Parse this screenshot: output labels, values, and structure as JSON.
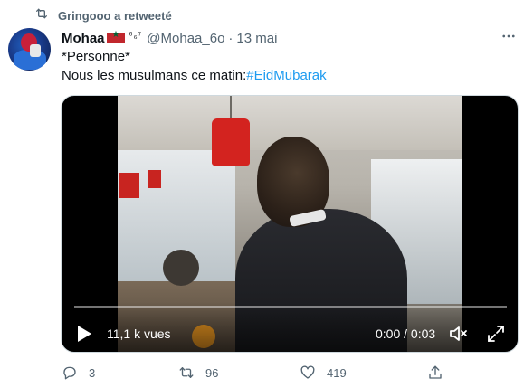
{
  "retweet": {
    "text": "Gringooo a retweeté"
  },
  "author": {
    "name": "Mohaa",
    "badge": "⁶₆⁷",
    "handle": "@Mohaa_6o",
    "separator": "·",
    "date": "13 mai"
  },
  "tweet": {
    "line1": "*Personne*",
    "line2_text": "Nous les musulmans ce matin:",
    "hashtag": "#EidMubarak"
  },
  "video": {
    "views": "11,1 k vues",
    "time": "0:00 / 0:03",
    "progress": 0.0
  },
  "actions": {
    "replies": "3",
    "retweets": "96",
    "likes": "419"
  },
  "colors": {
    "accent": "#1d9bf0",
    "secondary_text": "#536471",
    "flag_red": "#c1272d",
    "flag_green": "#006233"
  },
  "icons": [
    "retweet-icon",
    "more-icon",
    "play-icon",
    "volume-icon",
    "fullscreen-icon",
    "reply-icon",
    "like-icon",
    "share-icon"
  ]
}
